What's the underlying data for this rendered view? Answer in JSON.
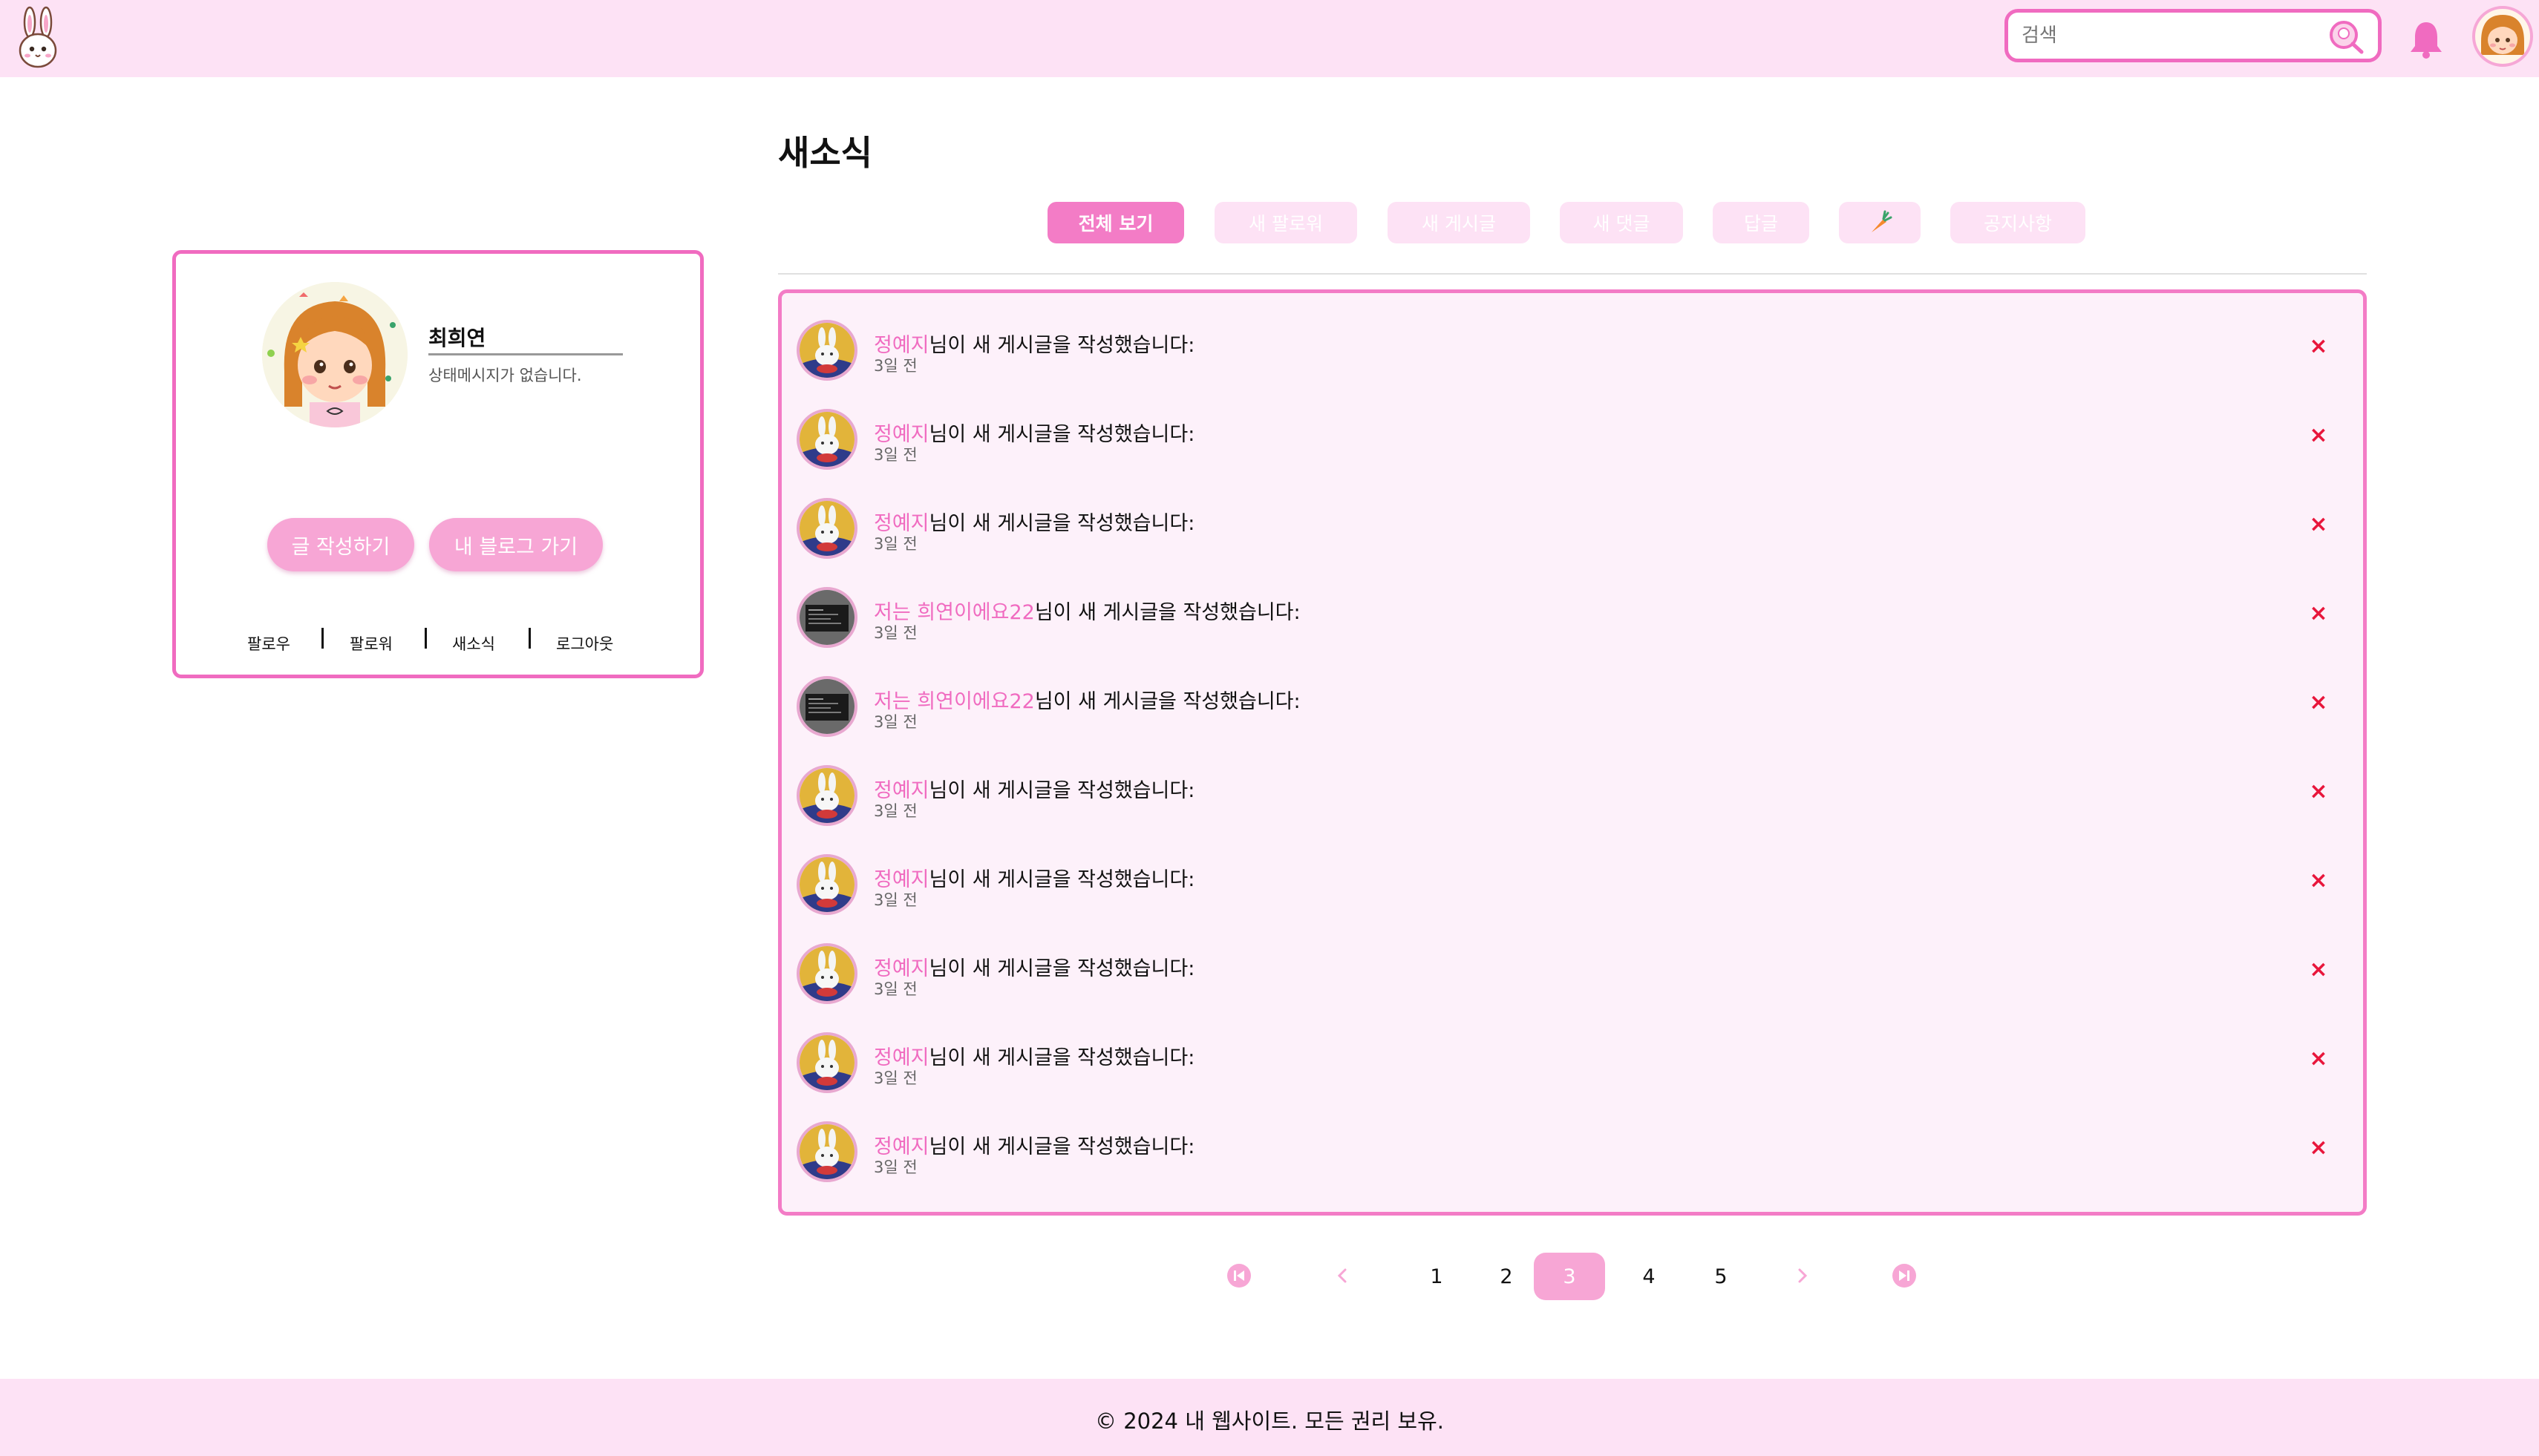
{
  "header": {
    "search_placeholder": "검색",
    "logo_icon": "bunny-logo-icon",
    "search_icon": "search-icon",
    "bell_icon": "bell-icon",
    "avatar_icon": "user-avatar"
  },
  "profile": {
    "name": "최희연",
    "status": "상태메시지가 없습니다.",
    "write_button": "글 작성하기",
    "blog_button": "내 블로그 가기",
    "links": [
      "팔로우",
      "팔로워",
      "새소식",
      "로그아웃"
    ]
  },
  "page": {
    "title": "새소식"
  },
  "tabs": [
    {
      "label": "전체 보기",
      "active": true
    },
    {
      "label": "새 팔로워",
      "active": false
    },
    {
      "label": "새 게시글",
      "active": false
    },
    {
      "label": "새 댓글",
      "active": false
    },
    {
      "label": "답글",
      "active": false
    },
    {
      "label": "",
      "icon": "carrot-icon",
      "active": false
    },
    {
      "label": "공지사항",
      "active": false
    }
  ],
  "notifications": [
    {
      "nick": "정예지",
      "message": "님이 새 게시글을 작성했습니다:",
      "time": "3일 전",
      "avatar": "bunny-avatar"
    },
    {
      "nick": "정예지",
      "message": "님이 새 게시글을 작성했습니다:",
      "time": "3일 전",
      "avatar": "bunny-avatar"
    },
    {
      "nick": "정예지",
      "message": "님이 새 게시글을 작성했습니다:",
      "time": "3일 전",
      "avatar": "bunny-avatar"
    },
    {
      "nick": "저는 희연이에요22",
      "message": "님이 새 게시글을 작성했습니다:",
      "time": "3일 전",
      "avatar": "screen-avatar"
    },
    {
      "nick": "저는 희연이에요22",
      "message": "님이 새 게시글을 작성했습니다:",
      "time": "3일 전",
      "avatar": "screen-avatar"
    },
    {
      "nick": "정예지",
      "message": "님이 새 게시글을 작성했습니다:",
      "time": "3일 전",
      "avatar": "bunny-avatar"
    },
    {
      "nick": "정예지",
      "message": "님이 새 게시글을 작성했습니다:",
      "time": "3일 전",
      "avatar": "bunny-avatar"
    },
    {
      "nick": "정예지",
      "message": "님이 새 게시글을 작성했습니다:",
      "time": "3일 전",
      "avatar": "bunny-avatar"
    },
    {
      "nick": "정예지",
      "message": "님이 새 게시글을 작성했습니다:",
      "time": "3일 전",
      "avatar": "bunny-avatar"
    },
    {
      "nick": "정예지",
      "message": "님이 새 게시글을 작성했습니다:",
      "time": "3일 전",
      "avatar": "bunny-avatar"
    }
  ],
  "delete_symbol": "×",
  "pagination": {
    "pages": [
      "1",
      "2",
      "3",
      "4",
      "5"
    ],
    "current": "3"
  },
  "footer": {
    "text": "© 2024 내 웹사이트. 모든 권리 보유."
  },
  "colors": {
    "accent": "#f06bc0",
    "header_bg": "#fde2f5",
    "list_bg": "#fdf1fa",
    "delete": "#e8163b"
  }
}
